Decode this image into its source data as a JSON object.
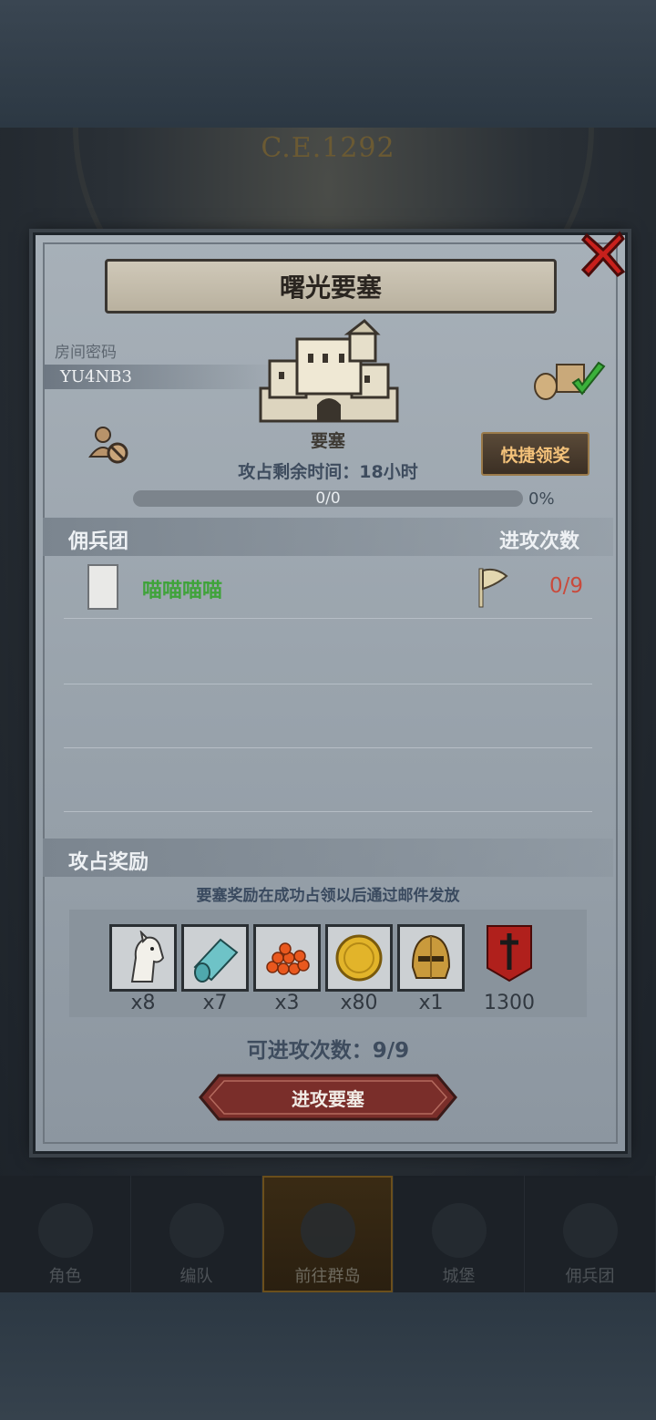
{
  "era_label": "C.E.1292",
  "dialog": {
    "title": "曙光要塞",
    "room_password_label": "房间密码",
    "room_code": "YU4NB3",
    "castle_label": "要塞",
    "quick_claim_label": "快捷领奖",
    "remaining_time_text": "攻占剩余时间：18小时",
    "progress_text": "0/0",
    "progress_percent_text": "0%",
    "progress_fraction": 0,
    "mercenary_header": "佣兵团",
    "attack_count_header": "进攻次数",
    "mercenaries": [
      {
        "name": "喵喵喵喵",
        "count": "0/9"
      }
    ],
    "rewards_header": "攻占奖励",
    "rewards_note": "要塞奖励在成功占领以后通过邮件发放",
    "rewards": [
      {
        "icon": "horse-icon",
        "count": "x8"
      },
      {
        "icon": "cloth-roll-icon",
        "count": "x7"
      },
      {
        "icon": "orange-gems-icon",
        "count": "x3"
      },
      {
        "icon": "gold-coin-icon",
        "count": "x80"
      },
      {
        "icon": "helmet-icon",
        "count": "x1"
      },
      {
        "icon": "red-banner-icon",
        "count": "1300"
      }
    ],
    "available_attacks_text": "可进攻次数：9/9",
    "attack_button_label": "进攻要塞"
  },
  "nav": {
    "items": [
      {
        "label": "角色",
        "icon": "knight-icon"
      },
      {
        "label": "编队",
        "icon": "formation-icon"
      },
      {
        "label": "前往群岛",
        "icon": "compass-icon"
      },
      {
        "label": "城堡",
        "icon": "castle-icon"
      },
      {
        "label": "佣兵团",
        "icon": "ship-icon"
      }
    ]
  },
  "colors": {
    "merc_name": "#3fa33a",
    "attack_count": "#c94a3c",
    "quick_claim_text": "#f4c27a",
    "attack_button": "#7a2e2a"
  }
}
